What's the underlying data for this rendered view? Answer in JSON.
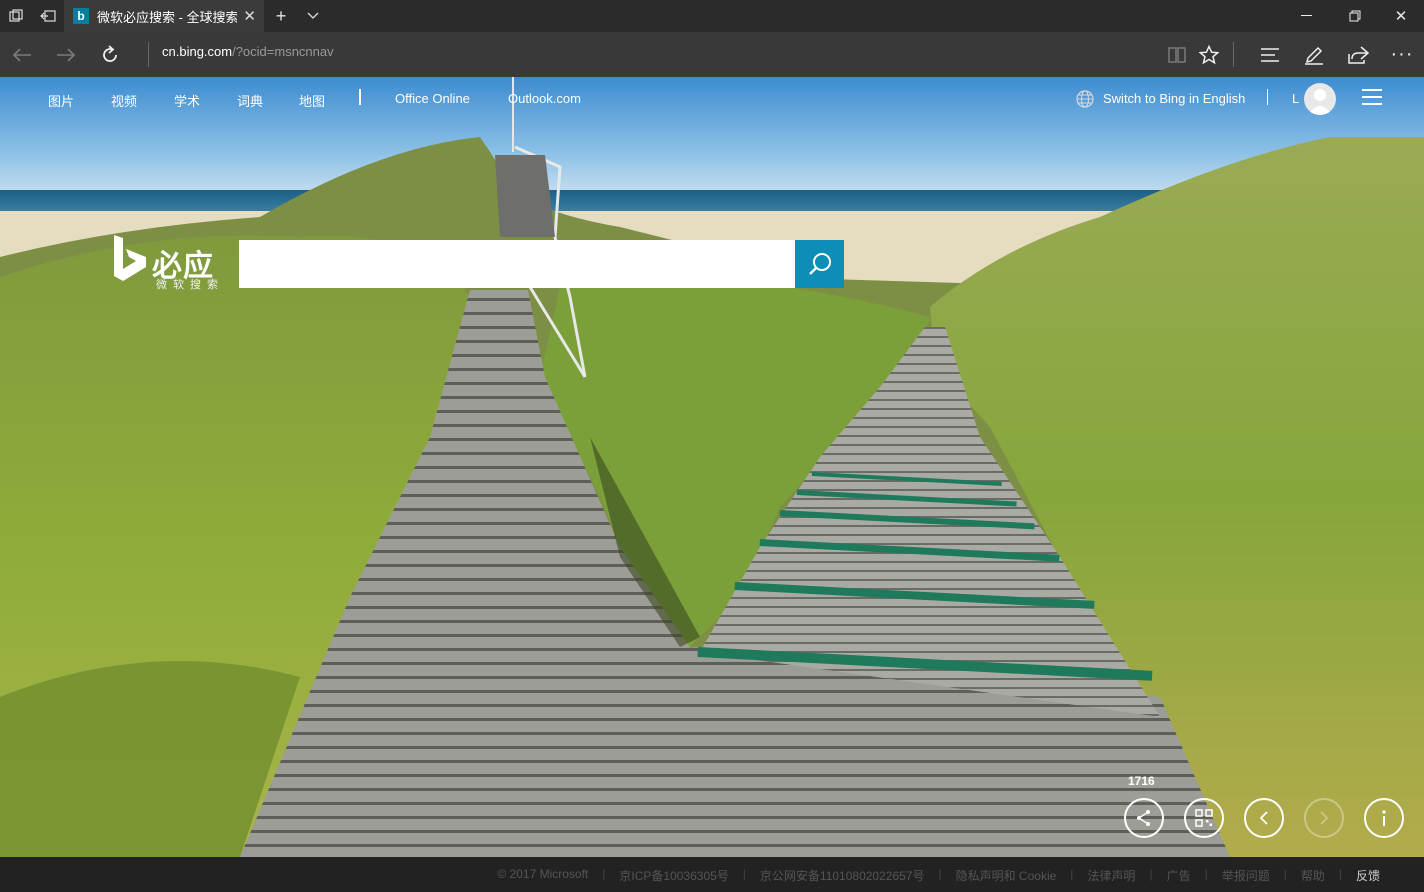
{
  "browser": {
    "tab": {
      "title": "微软必应搜索 - 全球搜索",
      "favicon": "b"
    },
    "address": {
      "host": "cn.bing.com",
      "path": "/?ocid=msncnnav"
    }
  },
  "topnav": {
    "items": [
      "图片",
      "视频",
      "学术",
      "词典",
      "地图"
    ],
    "links": [
      "Office Online",
      "Outlook.com"
    ],
    "switch_language": "Switch to Bing in English",
    "user_initial": "L"
  },
  "logo": {
    "text": "必应",
    "subtitle": "微软搜索"
  },
  "search": {
    "value": "",
    "placeholder": ""
  },
  "gallery": {
    "counter": "1716"
  },
  "footer": {
    "items": [
      "© 2017 Microsoft",
      "京ICP备10036305号",
      "京公网安备11010802022657号",
      "隐私声明和 Cookie",
      "法律声明",
      "广告",
      "举报问题",
      "帮助",
      "反馈"
    ]
  },
  "colors": {
    "search_button": "#0c8eb6",
    "chrome_dark": "#2b2b2b",
    "address_bar": "#393939"
  }
}
